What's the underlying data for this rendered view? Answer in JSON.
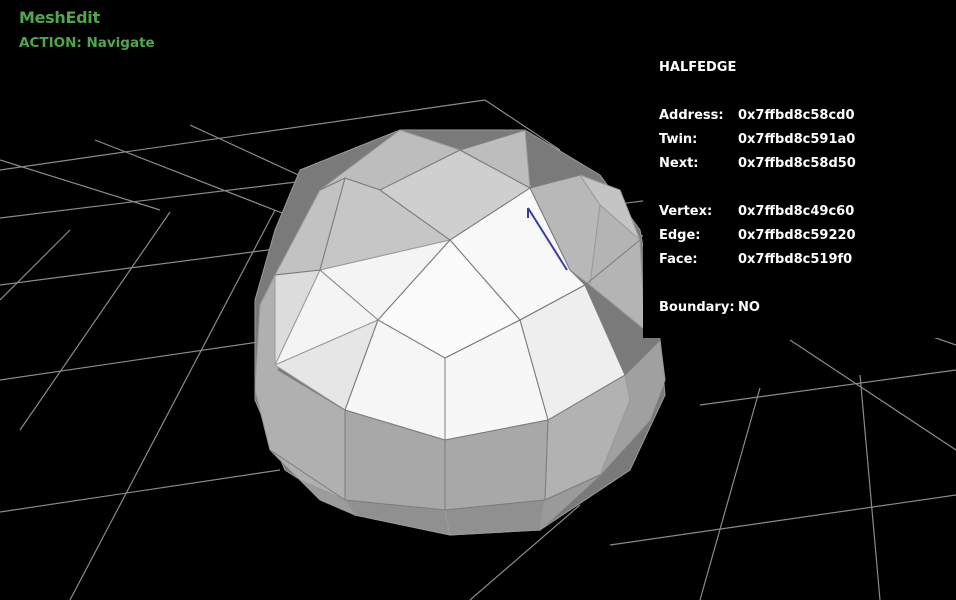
{
  "app": {
    "title": "MeshEdit",
    "action": "ACTION: Navigate"
  },
  "info": {
    "heading": "HALFEDGE",
    "rows": [
      {
        "label": "Address:",
        "value": "0x7ffbd8c58cd0"
      },
      {
        "label": "Twin:",
        "value": "0x7ffbd8c591a0"
      },
      {
        "label": "Next:",
        "value": "0x7ffbd8c58d50"
      },
      {
        "label": "Vertex:",
        "value": "0x7ffbd8c49c60"
      },
      {
        "label": "Edge:",
        "value": "0x7ffbd8c59220"
      },
      {
        "label": "Face:",
        "value": "0x7ffbd8c519f0"
      },
      {
        "label": "Boundary:",
        "value": "NO"
      }
    ]
  },
  "colors": {
    "background": "#000000",
    "hud_text": "#4ea84a",
    "grid": "#8a8a8a",
    "selected_halfedge": "#3a3aa8"
  }
}
